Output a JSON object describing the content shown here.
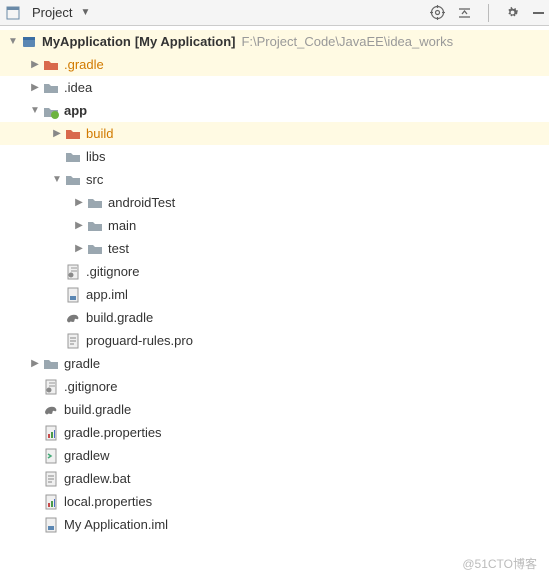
{
  "header": {
    "title": "Project",
    "icons": [
      "target-icon",
      "collapse-icon",
      "gear-icon",
      "hide-icon"
    ]
  },
  "tree": [
    {
      "depth": 0,
      "chev": "down",
      "icon": "project",
      "label": "MyApplication",
      "suffix": "[My Application]",
      "path": "F:\\Project_Code\\JavaEE\\idea_works",
      "bold": true,
      "selected": true
    },
    {
      "depth": 1,
      "chev": "right",
      "icon": "folder-exc",
      "label": ".gradle",
      "orange": true,
      "selected": true
    },
    {
      "depth": 1,
      "chev": "right",
      "icon": "folder",
      "label": ".idea"
    },
    {
      "depth": 1,
      "chev": "down",
      "icon": "module",
      "label": "app",
      "bold": true
    },
    {
      "depth": 2,
      "chev": "right",
      "icon": "folder-exc",
      "label": "build",
      "orange": true,
      "selected": true
    },
    {
      "depth": 2,
      "chev": "",
      "icon": "folder",
      "label": "libs"
    },
    {
      "depth": 2,
      "chev": "down",
      "icon": "folder",
      "label": "src"
    },
    {
      "depth": 3,
      "chev": "right",
      "icon": "folder",
      "label": "androidTest"
    },
    {
      "depth": 3,
      "chev": "right",
      "icon": "folder",
      "label": "main"
    },
    {
      "depth": 3,
      "chev": "right",
      "icon": "folder",
      "label": "test"
    },
    {
      "depth": 2,
      "chev": "",
      "icon": "gitfile",
      "label": ".gitignore"
    },
    {
      "depth": 2,
      "chev": "",
      "icon": "imlfile",
      "label": "app.iml"
    },
    {
      "depth": 2,
      "chev": "",
      "icon": "gradle",
      "label": "build.gradle"
    },
    {
      "depth": 2,
      "chev": "",
      "icon": "textfile",
      "label": "proguard-rules.pro"
    },
    {
      "depth": 1,
      "chev": "right",
      "icon": "folder",
      "label": "gradle"
    },
    {
      "depth": 1,
      "chev": "",
      "icon": "gitfile",
      "label": ".gitignore"
    },
    {
      "depth": 1,
      "chev": "",
      "icon": "gradle",
      "label": "build.gradle"
    },
    {
      "depth": 1,
      "chev": "",
      "icon": "propfile",
      "label": "gradle.properties"
    },
    {
      "depth": 1,
      "chev": "",
      "icon": "shfile",
      "label": "gradlew"
    },
    {
      "depth": 1,
      "chev": "",
      "icon": "batfile",
      "label": "gradlew.bat"
    },
    {
      "depth": 1,
      "chev": "",
      "icon": "propfile",
      "label": "local.properties"
    },
    {
      "depth": 1,
      "chev": "",
      "icon": "imlfile",
      "label": "My Application.iml"
    }
  ],
  "watermark": "@51CTO博客"
}
